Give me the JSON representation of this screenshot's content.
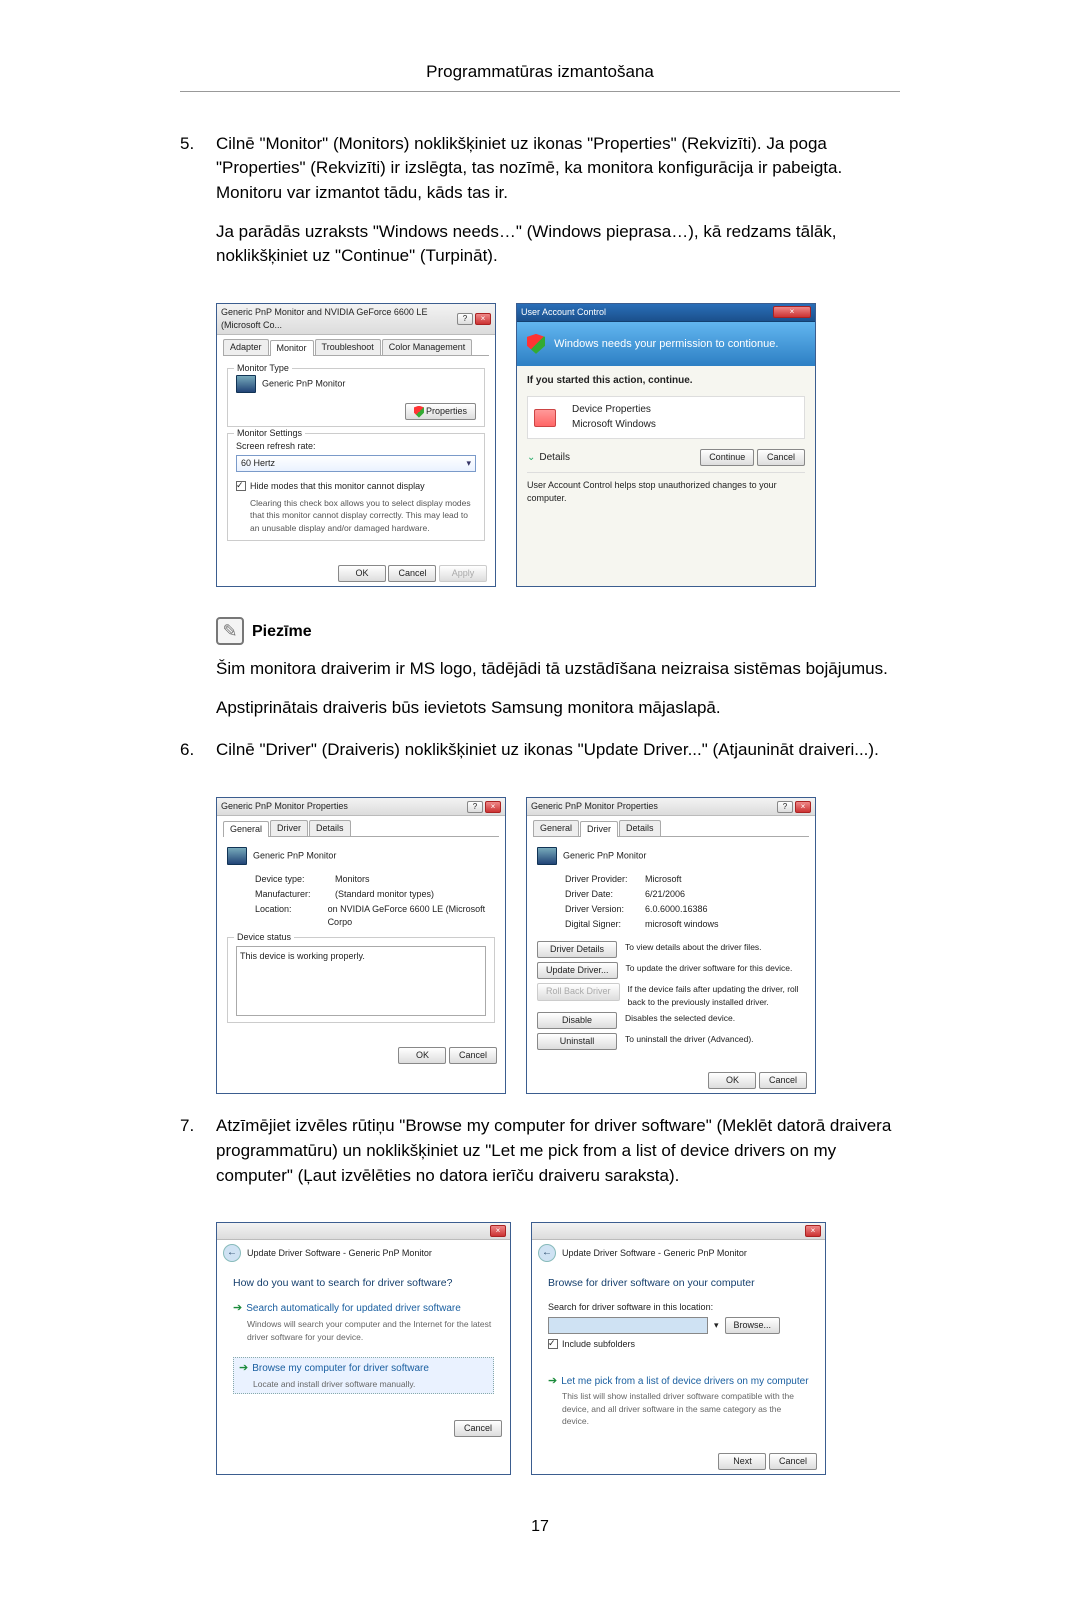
{
  "page": {
    "header": "Programmatūras izmantošana",
    "number": "17"
  },
  "step5": {
    "num": "5.",
    "para1": "Cilnē \"Monitor\" (Monitors) noklikšķiniet uz ikonas \"Properties\" (Rekvizīti). Ja poga \"Properties\" (Rekvizīti) ir izslēgta, tas nozīmē, ka monitora konfigurācija ir pabeigta. Monitoru var izmantot tādu, kāds tas ir.",
    "para2": "Ja parādās uzraksts \"Windows needs…\" (Windows pieprasa…), kā redzams tālāk, noklikšķiniet uz \"Continue\" (Turpināt)."
  },
  "fig1_left": {
    "title": "Generic PnP Monitor and NVIDIA GeForce 6600 LE (Microsoft Co...",
    "tabs": {
      "adapter": "Adapter",
      "monitor": "Monitor",
      "troubleshoot": "Troubleshoot",
      "color": "Color Management"
    },
    "monType": "Monitor Type",
    "monName": "Generic PnP Monitor",
    "properties": "Properties",
    "monSettings": "Monitor Settings",
    "refresh": "Screen refresh rate:",
    "hz": "60 Hertz",
    "hideModes": "Hide modes that this monitor cannot display",
    "hideModesHelp": "Clearing this check box allows you to select display modes that this monitor cannot display correctly. This may lead to an unusable display and/or damaged hardware.",
    "ok": "OK",
    "cancel": "Cancel",
    "apply": "Apply"
  },
  "fig1_right": {
    "title": "User Account Control",
    "band": "Windows needs your permission to contionue.",
    "started": "If you started this action, continue.",
    "devProps": "Device Properties",
    "msw": "Microsoft Windows",
    "details": "Details",
    "continue": "Continue",
    "cancel": "Cancel",
    "footer": "User Account Control helps stop unauthorized changes to your computer."
  },
  "note": {
    "label": "Piezīme",
    "p1": "Šim monitora draiverim ir MS logo, tādējādi tā uzstādīšana neizraisa sistēmas bojājumus.",
    "p2": "Apstiprinātais draiveris būs ievietots Samsung monitora mājaslapā."
  },
  "step6": {
    "num": "6.",
    "para": "Cilnē \"Driver\" (Draiveris) noklikšķiniet uz ikonas \"Update Driver...\" (Atjaunināt draiveri...)."
  },
  "fig2_left": {
    "title": "Generic PnP Monitor Properties",
    "tabs": {
      "general": "General",
      "driver": "Driver",
      "details": "Details"
    },
    "name": "Generic PnP Monitor",
    "devtype_k": "Device type:",
    "devtype_v": "Monitors",
    "manu_k": "Manufacturer:",
    "manu_v": "(Standard monitor types)",
    "loc_k": "Location:",
    "loc_v": "on NVIDIA GeForce 6600 LE (Microsoft Corpo",
    "status_legend": "Device status",
    "status_text": "This device is working properly.",
    "ok": "OK",
    "cancel": "Cancel"
  },
  "fig2_right": {
    "title": "Generic PnP Monitor Properties",
    "tabs": {
      "general": "General",
      "driver": "Driver",
      "details": "Details"
    },
    "name": "Generic PnP Monitor",
    "prov_k": "Driver Provider:",
    "prov_v": "Microsoft",
    "date_k": "Driver Date:",
    "date_v": "6/21/2006",
    "ver_k": "Driver Version:",
    "ver_v": "6.0.6000.16386",
    "sig_k": "Digital Signer:",
    "sig_v": "microsoft windows",
    "btn_details": "Driver Details",
    "desc_details": "To view details about the driver files.",
    "btn_update": "Update Driver...",
    "desc_update": "To update the driver software for this device.",
    "btn_roll": "Roll Back Driver",
    "desc_roll": "If the device fails after updating the driver, roll back to the previously installed driver.",
    "btn_disable": "Disable",
    "desc_disable": "Disables the selected device.",
    "btn_uninstall": "Uninstall",
    "desc_uninstall": "To uninstall the driver (Advanced).",
    "ok": "OK",
    "cancel": "Cancel"
  },
  "step7": {
    "num": "7.",
    "para": "Atzīmējiet izvēles rūtiņu \"Browse my computer for driver software\" (Meklēt datorā draivera programmatūru) un noklikšķiniet uz \"Let me pick from a list of device drivers on my computer\" (Ļaut izvēlēties no datora ierīču draiveru saraksta)."
  },
  "fig3_left": {
    "crumb": "Update Driver Software - Generic PnP Monitor",
    "heading": "How do you want to search for driver software?",
    "opt1_t": "Search automatically for updated driver software",
    "opt1_s": "Windows will search your computer and the Internet for the latest driver software for your device.",
    "opt2_t": "Browse my computer for driver software",
    "opt2_s": "Locate and install driver software manually.",
    "cancel": "Cancel"
  },
  "fig3_right": {
    "crumb": "Update Driver Software - Generic PnP Monitor",
    "heading": "Browse for driver software on your computer",
    "search_label": "Search for driver software in this location:",
    "browse": "Browse...",
    "include": "Include subfolders",
    "opt_t": "Let me pick from a list of device drivers on my computer",
    "opt_s": "This list will show installed driver software compatible with the device, and all driver software in the same category as the device.",
    "next": "Next",
    "cancel": "Cancel"
  }
}
